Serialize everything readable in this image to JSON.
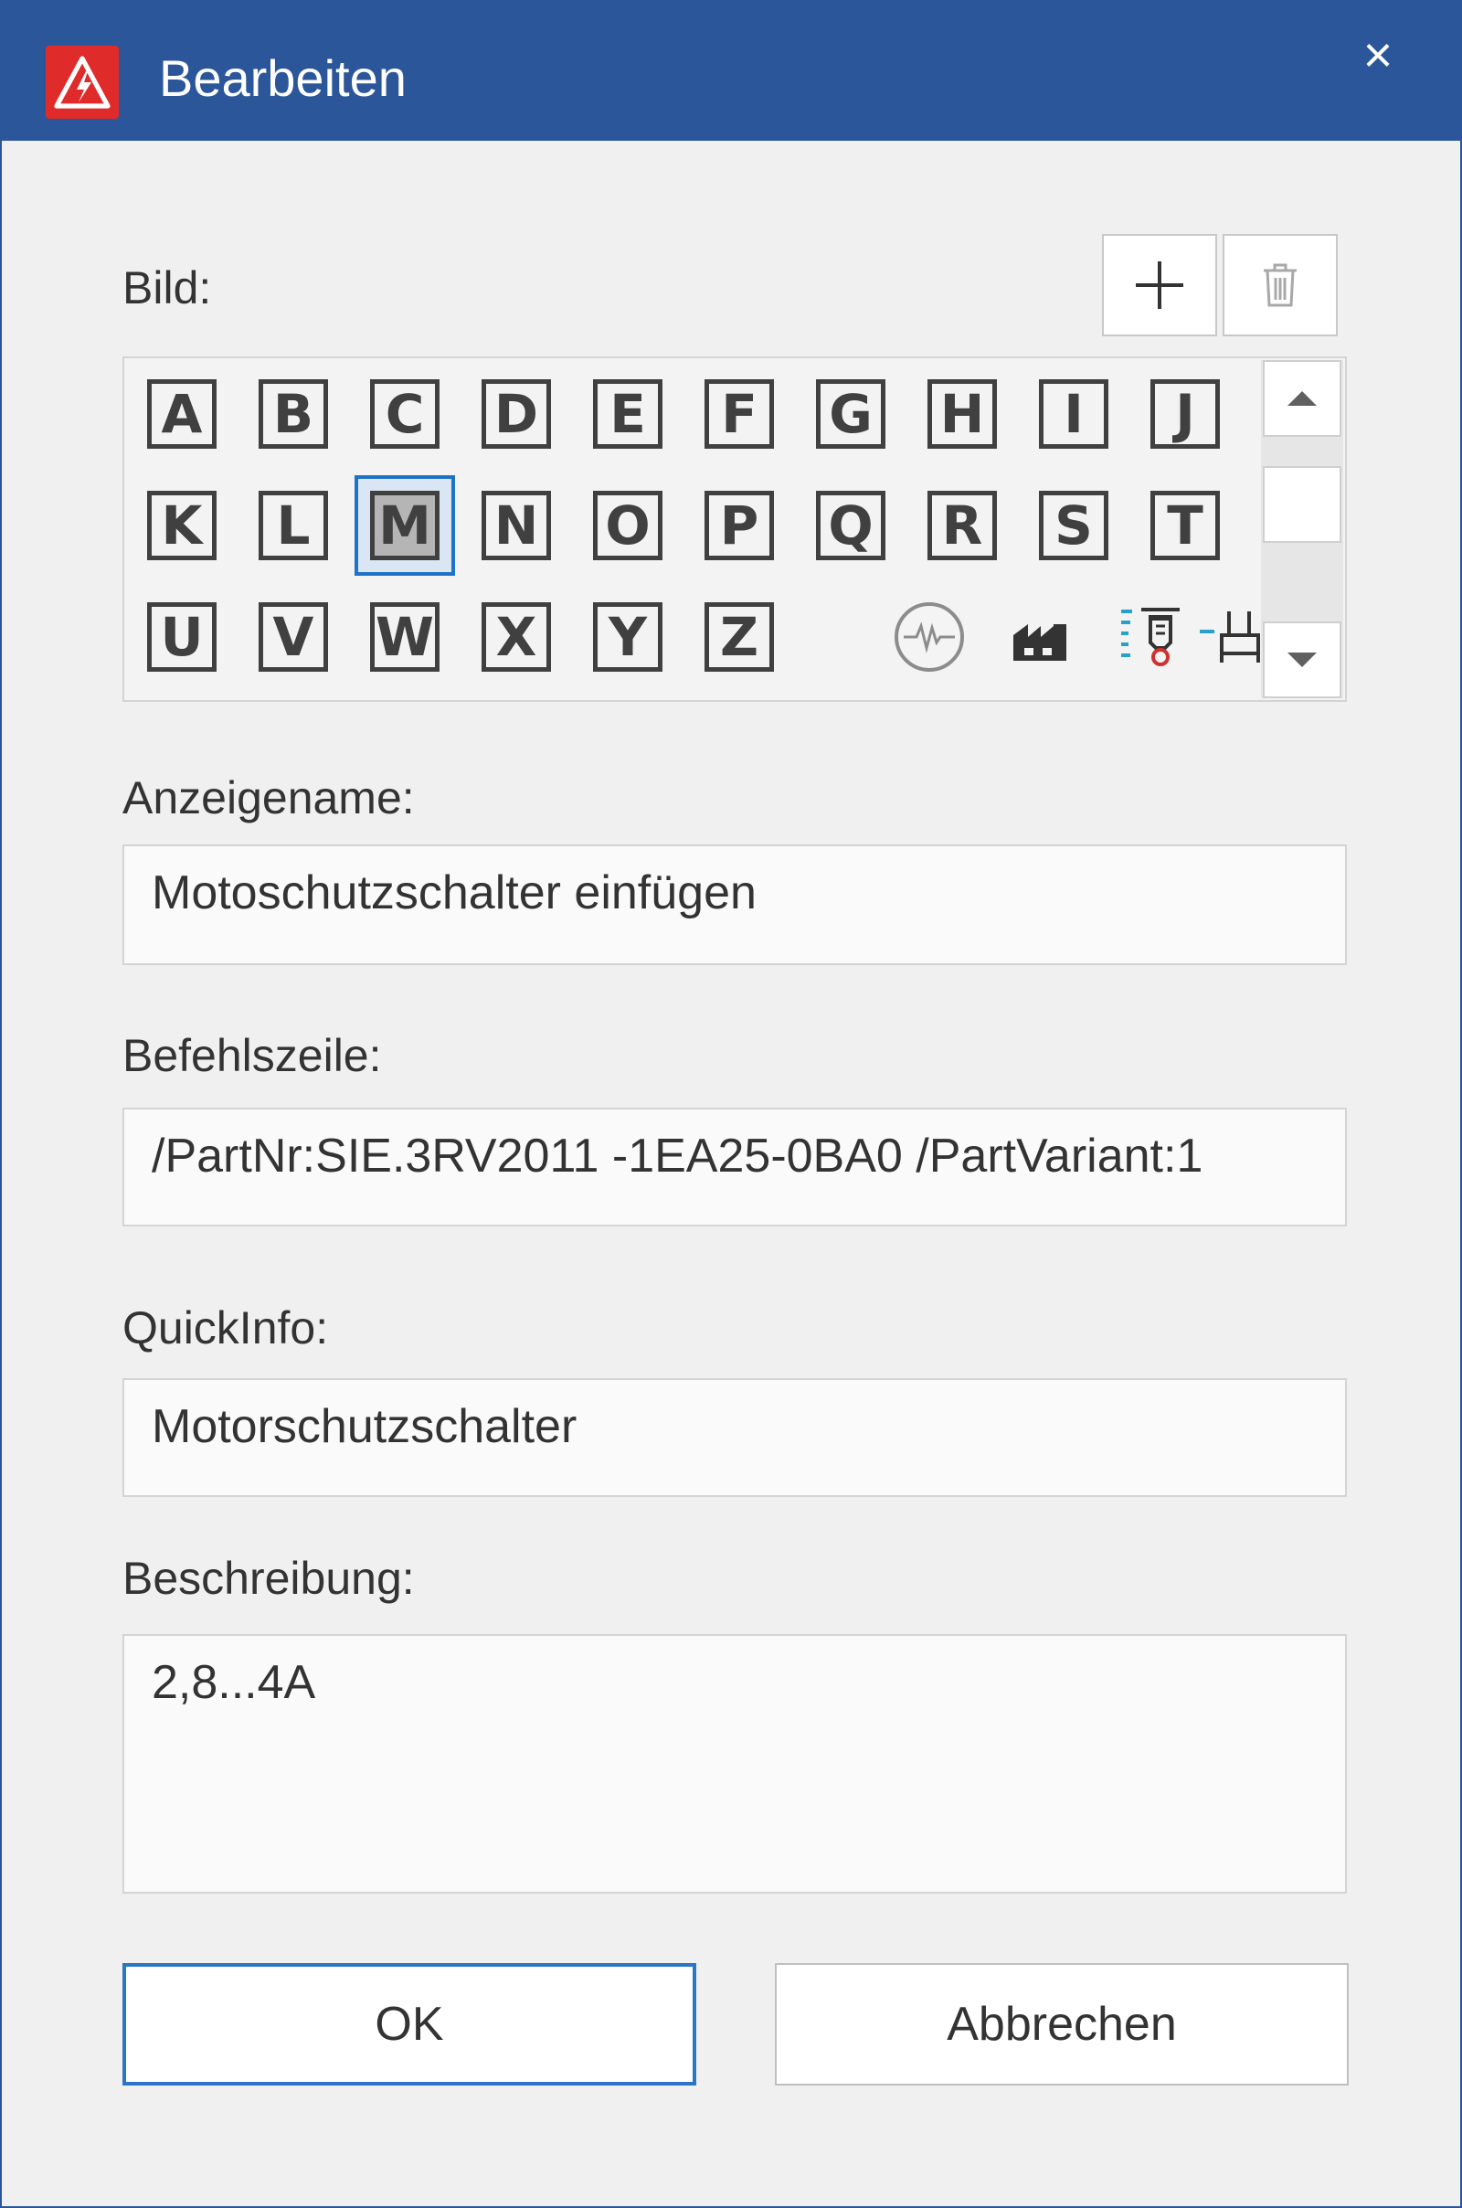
{
  "window": {
    "title": "Bearbeiten",
    "close_glyph": "×",
    "app_icon": "warning-triangle-icon",
    "accent": "#2b579a",
    "icon_color": "#e02b2b"
  },
  "image_picker": {
    "label": "Bild:",
    "add_glyph": "+",
    "rows": [
      [
        "A",
        "B",
        "C",
        "D",
        "E",
        "F",
        "G",
        "H",
        "I",
        "J"
      ],
      [
        "K",
        "L",
        "M",
        "N",
        "O",
        "P",
        "Q",
        "R",
        "S",
        "T"
      ],
      [
        "U",
        "V",
        "W",
        "X",
        "Y",
        "Z"
      ]
    ],
    "selected": "M",
    "extra_icons": [
      "oscilloscope-icon",
      "factory-icon",
      "sensor-icon",
      "terminal-icon"
    ]
  },
  "display_name": {
    "label": "Anzeigename:",
    "value": "Motoschutzschalter einfügen"
  },
  "command_line": {
    "label": "Befehlszeile:",
    "value": "/PartNr:SIE.3RV2011 -1EA25-0BA0 /PartVariant:1"
  },
  "quickinfo": {
    "label": "QuickInfo:",
    "value": "Motorschutzschalter"
  },
  "description": {
    "label": "Beschreibung:",
    "value": "2,8...4A"
  },
  "buttons": {
    "ok": "OK",
    "cancel": "Abbrechen"
  }
}
